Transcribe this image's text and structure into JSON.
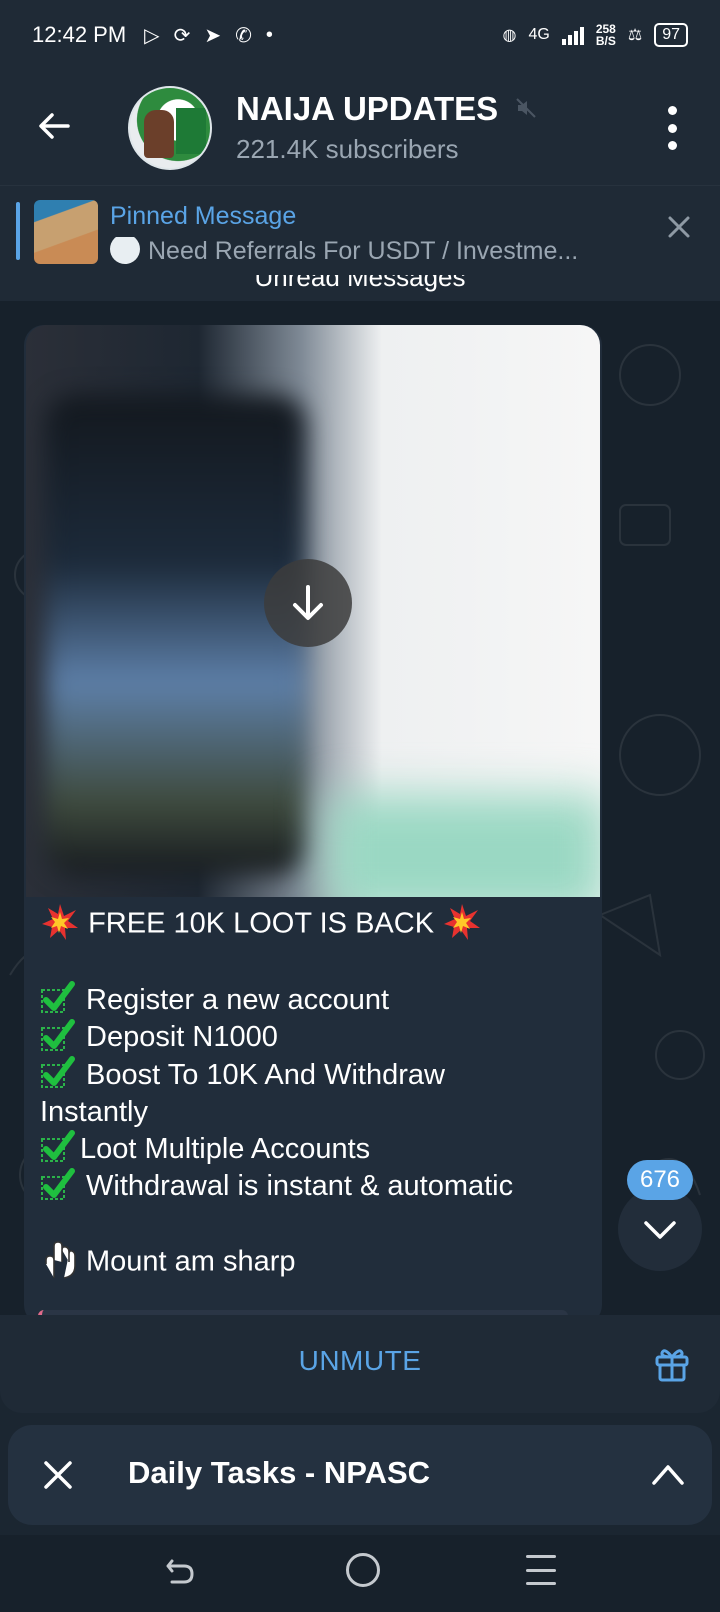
{
  "status_bar": {
    "time": "12:42 PM",
    "network": "4G",
    "net_speed_value": "258",
    "net_speed_unit": "B/S",
    "battery": "97"
  },
  "header": {
    "channel_name": "NAIJA UPDATES",
    "subscribers": "221.4K subscribers",
    "avatar_label": "UPDATES"
  },
  "pinned": {
    "title": "Pinned Message",
    "text": "Need Referrals For USDT / Investme..."
  },
  "chat": {
    "unread_divider": "Unread Messages",
    "message": {
      "title": "FREE 10K LOOT IS BACK",
      "items": [
        "Register a new account",
        "Deposit N1000",
        "Boost To 10K And Withdraw"
      ],
      "item3_wrap": "Instantly",
      "item4": "Loot Multiple Accounts",
      "item5": "Withdrawal is instant & automatic",
      "cta": "Mount am sharp"
    },
    "unread_count": "676"
  },
  "bottom_bar": {
    "unmute_label": "UNMUTE"
  },
  "floating": {
    "title": "Daily Tasks - NPASC"
  },
  "colors": {
    "accent": "#5aa4e6",
    "bubble": "#212d3b",
    "chat_bg": "#17212b",
    "header_bg": "#1f2a36"
  }
}
